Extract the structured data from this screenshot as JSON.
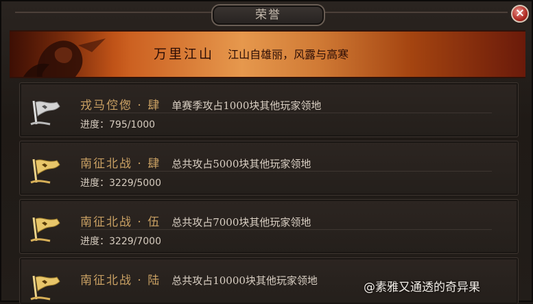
{
  "window": {
    "title": "荣誉",
    "close_symbol": "×"
  },
  "banner": {
    "name": "万里江山",
    "description": "江山自雄丽，风露与高寒"
  },
  "achievements": [
    {
      "name": "戎马倥偬 · 肆",
      "description": "单赛季攻占1000块其他玩家领地",
      "progress": "进度：795/1000",
      "progress_fraction": 0.795,
      "flag_color": "silver"
    },
    {
      "name": "南征北战 · 肆",
      "description": "总共攻占5000块其他玩家领地",
      "progress": "进度：3229/5000",
      "progress_fraction": 0.6458,
      "flag_color": "gold"
    },
    {
      "name": "南征北战 · 伍",
      "description": "总共攻占7000块其他玩家领地",
      "progress": "进度：3229/7000",
      "progress_fraction": 0.4613,
      "flag_color": "gold"
    },
    {
      "name": "南征北战 · 陆",
      "description": "总共攻占10000块其他玩家领地",
      "progress": "",
      "flag_color": "gold"
    }
  ],
  "watermark": "@素雅又通透的奇异果",
  "colors": {
    "title_gold": "#c9a063",
    "banner_orange": "#e6984d",
    "close_red": "#b02a22"
  }
}
